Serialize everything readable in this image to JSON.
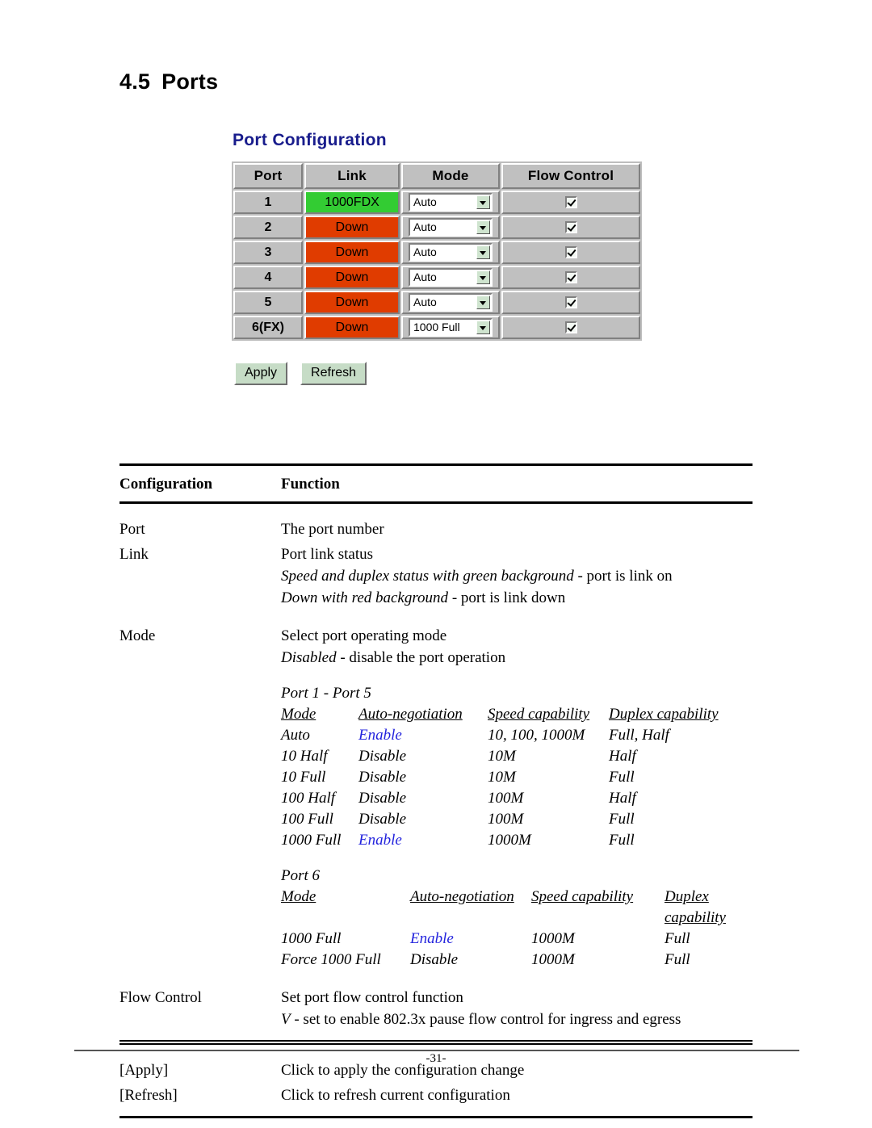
{
  "document": {
    "section_number": "4.5",
    "section_title": "Ports",
    "page_number": "-31-"
  },
  "screenshot": {
    "title": "Port Configuration",
    "table": {
      "headers": [
        "Port",
        "Link",
        "Mode",
        "Flow Control"
      ],
      "rows": [
        {
          "port": "1",
          "link": "1000FDX",
          "link_state": "up",
          "mode": "Auto",
          "flow_control": true
        },
        {
          "port": "2",
          "link": "Down",
          "link_state": "down",
          "mode": "Auto",
          "flow_control": true
        },
        {
          "port": "3",
          "link": "Down",
          "link_state": "down",
          "mode": "Auto",
          "flow_control": true
        },
        {
          "port": "4",
          "link": "Down",
          "link_state": "down",
          "mode": "Auto",
          "flow_control": true
        },
        {
          "port": "5",
          "link": "Down",
          "link_state": "down",
          "mode": "Auto",
          "flow_control": true
        },
        {
          "port": "6(FX)",
          "link": "Down",
          "link_state": "down",
          "mode": "1000 Full",
          "flow_control": true
        }
      ]
    },
    "buttons": {
      "apply": "Apply",
      "refresh": "Refresh"
    },
    "colors": {
      "title": "#181c8c",
      "link_up_bg": "#33cc33",
      "link_down_bg": "#e03c00",
      "cell_bg": "#c0c0c0",
      "button_bg": "#c6dcc6",
      "select_arrow_bg": "#cfe4cf"
    }
  },
  "description_table": {
    "headers": {
      "col1": "Configuration",
      "col2": "Function"
    },
    "rows": [
      {
        "config": "Port",
        "lines": [
          {
            "text": "The port number",
            "style": "normal"
          }
        ]
      },
      {
        "config": "Link",
        "lines": [
          {
            "text": "Port link status",
            "style": "normal"
          },
          {
            "text_italic": "Speed and duplex status with green background",
            "text_normal": " - port is link on",
            "style": "mixed"
          },
          {
            "text_italic": "Down with red background",
            "text_normal": " - port is link down",
            "style": "mixed"
          }
        ]
      },
      {
        "config": "Mode",
        "lines": [
          {
            "text": "Select port operating mode",
            "style": "normal"
          },
          {
            "text_italic": "Disabled",
            "text_normal": " - disable the port operation",
            "style": "mixed"
          }
        ]
      },
      {
        "config": "Flow Control",
        "lines": [
          {
            "text": "Set port flow control function",
            "style": "normal"
          },
          {
            "text_italic": "V",
            "text_normal": " - set to enable 802.3x pause flow control for ingress and egress",
            "style": "mixed"
          }
        ]
      }
    ],
    "action_rows": [
      {
        "config": "[Apply]",
        "function": "Click to apply the configuration change"
      },
      {
        "config": "[Refresh]",
        "function": "Click to refresh current configuration"
      }
    ]
  },
  "mode_tables": [
    {
      "caption": "Port 1 - Port 5",
      "headers": [
        "Mode",
        "Auto-negotiation",
        "Speed capability",
        "Duplex capability"
      ],
      "rows": [
        {
          "mode": "Auto",
          "autoneg": "Enable",
          "autoneg_highlight": true,
          "speed": "10, 100, 1000M",
          "duplex": "Full, Half"
        },
        {
          "mode": "10 Half",
          "autoneg": "Disable",
          "autoneg_highlight": false,
          "speed": "10M",
          "duplex": "Half"
        },
        {
          "mode": "10 Full",
          "autoneg": "Disable",
          "autoneg_highlight": false,
          "speed": "10M",
          "duplex": "Full"
        },
        {
          "mode": "100 Half",
          "autoneg": "Disable",
          "autoneg_highlight": false,
          "speed": "100M",
          "duplex": "Half"
        },
        {
          "mode": "100 Full",
          "autoneg": "Disable",
          "autoneg_highlight": false,
          "speed": "100M",
          "duplex": "Full"
        },
        {
          "mode": "1000 Full",
          "autoneg": "Enable",
          "autoneg_highlight": true,
          "speed": "1000M",
          "duplex": "Full"
        }
      ]
    },
    {
      "caption": "Port 6",
      "headers": [
        "Mode",
        "Auto-negotiation",
        "Speed capability",
        "Duplex capability"
      ],
      "rows": [
        {
          "mode": "1000 Full",
          "autoneg": "Enable",
          "autoneg_highlight": true,
          "speed": "1000M",
          "duplex": "Full"
        },
        {
          "mode": "Force 1000 Full",
          "autoneg": "Disable",
          "autoneg_highlight": false,
          "speed": "1000M",
          "duplex": "Full"
        }
      ]
    }
  ]
}
